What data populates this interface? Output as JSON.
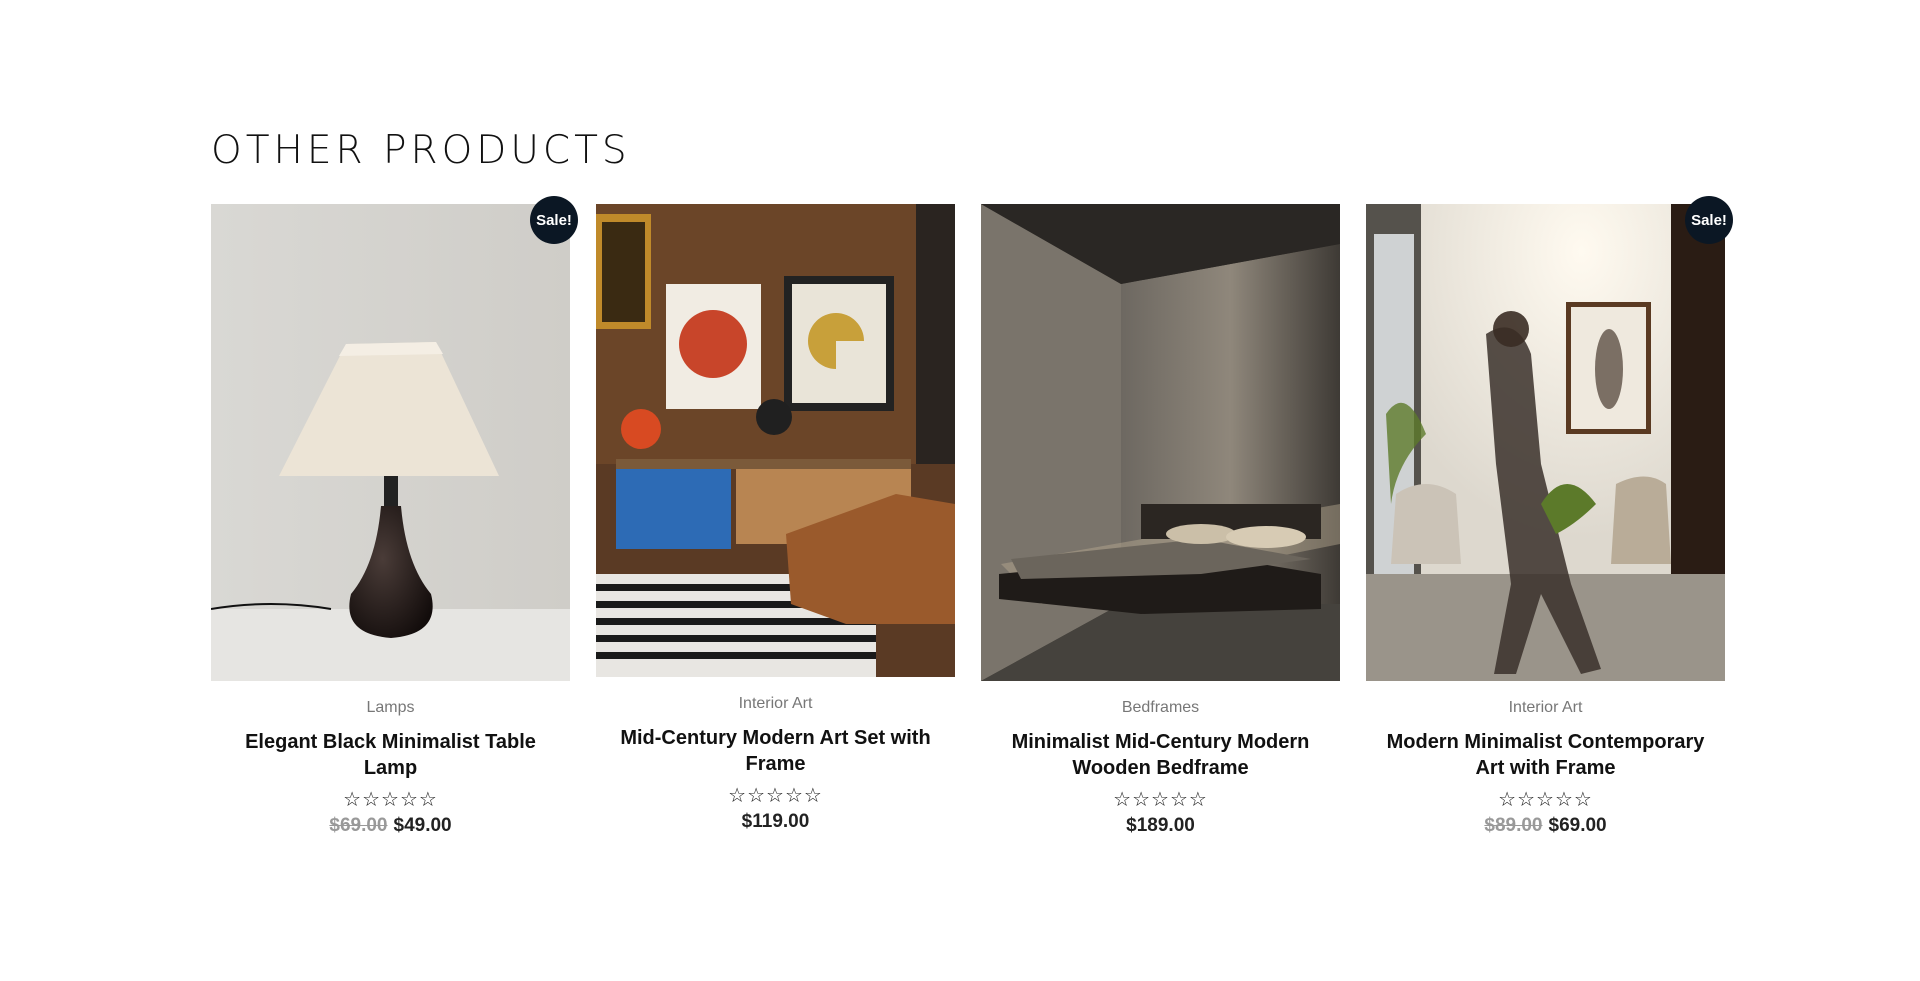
{
  "section": {
    "title": "OTHER PRODUCTS"
  },
  "products": [
    {
      "category": "Lamps",
      "title": "Elegant Black Minimalist Table Lamp",
      "rating": 0,
      "stars": "☆☆☆☆☆",
      "price_old": "$69.00",
      "price": "$49.00",
      "badge": "Sale!",
      "image_icon": "table-lamp-photo"
    },
    {
      "category": "Interior Art",
      "title": "Mid-Century Modern Art Set with Frame",
      "rating": 0,
      "stars": "☆☆☆☆☆",
      "price_old": "",
      "price": "$119.00",
      "badge": "",
      "image_icon": "art-room-photo"
    },
    {
      "category": "Bedframes",
      "title": "Minimalist Mid-Century Modern Wooden Bedframe",
      "rating": 0,
      "stars": "☆☆☆☆☆",
      "price_old": "",
      "price": "$189.00",
      "badge": "",
      "image_icon": "bedroom-photo"
    },
    {
      "category": "Interior Art",
      "title": "Modern Minimalist Contemporary Art with Frame",
      "rating": 0,
      "stars": "☆☆☆☆☆",
      "price_old": "$89.00",
      "price": "$69.00",
      "badge": "Sale!",
      "image_icon": "gallery-walk-photo"
    }
  ],
  "colors": {
    "badge_bg": "#0b1724",
    "text": "#111111",
    "muted": "#777777"
  }
}
